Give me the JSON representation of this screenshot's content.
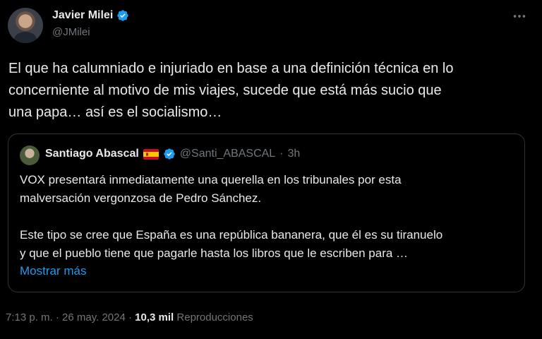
{
  "author": {
    "name": "Javier Milei",
    "handle": "@JMilei",
    "verified": true,
    "badge_color": "#1d9bf0"
  },
  "more_icon": "more-horizontal-icon",
  "tweet": {
    "lines": [
      "El que ha calumniado e injuriado en base a una definición técnica en lo",
      "concerniente al motivo de mis viajes, sucede que está más sucio que",
      "una papa… así es el socialismo…"
    ]
  },
  "quote": {
    "name": "Santiago Abascal",
    "flag": "spain-flag",
    "verified": true,
    "handle": "@Santi_ABASCAL",
    "separator": "·",
    "time": "3h",
    "paragraph1": [
      "VOX presentará inmediatamente una querella en los tribunales por esta",
      "malversación vergonzosa de Pedro Sánchez."
    ],
    "paragraph2": [
      "Este tipo se cree que España es una república bananera, que él es su tiranuelo",
      "y que el pueblo tiene que pagarle hasta los libros que le escriben para …"
    ],
    "show_more": "Mostrar más"
  },
  "meta": {
    "time": "7:13 p. m.",
    "sep1": "·",
    "date": "26 may. 2024",
    "sep2": "·",
    "views_count": "10,3 mil",
    "views_label": "Reproducciones"
  },
  "colors": {
    "background": "#000000",
    "text": "#e7e9ea",
    "muted": "#71767b",
    "link": "#1d9bf0",
    "border": "#2f3336"
  }
}
